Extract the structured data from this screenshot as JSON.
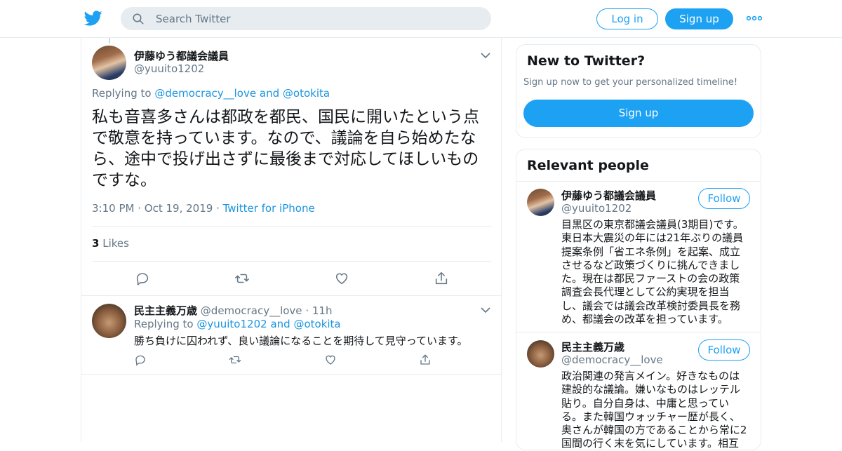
{
  "header": {
    "search_placeholder": "Search Twitter",
    "login_label": "Log in",
    "signup_label": "Sign up"
  },
  "main_tweet": {
    "display_name": "伊藤ゆう都議会議員",
    "handle": "@yuuito1202",
    "replying_prefix": "Replying to",
    "replying_to_1": "@democracy__love",
    "replying_and": "and",
    "replying_to_2": "@otokita",
    "text_line_1": "私も音喜多さんは都政を都民、国民に開いたという点",
    "text_line_2": "で敬意を持っています。なので、議論を自ら始めたな",
    "text_line_3": "ら、途中で投げ出さずに最後まで対応してほしいもの",
    "text_line_4": "ですな。",
    "time": "3:10 PM",
    "date": "Oct 19, 2019",
    "source": "Twitter for iPhone",
    "likes_count": "3",
    "likes_label": "Likes"
  },
  "reply_tweet": {
    "display_name": "民主主義万歳",
    "handle": "@democracy__love",
    "age": "11h",
    "replying_prefix": "Replying to",
    "replying_to_1": "@yuuito1202",
    "replying_and": "and",
    "replying_to_2": "@otokita",
    "text": "勝ち負けに囚われず、良い議論になることを期待して見守っています。"
  },
  "sidebar": {
    "new_title": "New to Twitter?",
    "new_subtitle": "Sign up now to get your personalized timeline!",
    "signup_label": "Sign up",
    "relevant_title": "Relevant people",
    "people": [
      {
        "name": "伊藤ゆう都議会議員",
        "handle": "@yuuito1202",
        "follow_label": "Follow",
        "bio_lines": [
          "目黒区の東京都議会議員(3期目)です。",
          "東日本大震災の年には21年ぶりの議員",
          "提案条例「省エネ条例」を起案、成立",
          "させるなど政策づくりに挑んできまし",
          "た。現在は都民ファーストの会の政策",
          "調査会長代理として公約実現を担当",
          "し、議会では議会改革検討委員長を務",
          "め、都議会の改革を担っています。"
        ]
      },
      {
        "name": "民主主義万歳",
        "handle": "@democracy__love",
        "follow_label": "Follow",
        "bio_lines": [
          "政治関連の発言メイン。好きなものは",
          "建設的な議論。嫌いなものはレッテル",
          "貼り。自分自身は、中庸と思ってい",
          "る。また韓国ウォッチャー歴が長く、",
          "奥さんが韓国の方であることから常に2",
          "国間の行く末を気にしています。相互"
        ]
      }
    ]
  },
  "colors": {
    "accent": "#1da1f2",
    "link": "#1b95e0",
    "muted": "#657786",
    "border": "#e6ecf0"
  }
}
